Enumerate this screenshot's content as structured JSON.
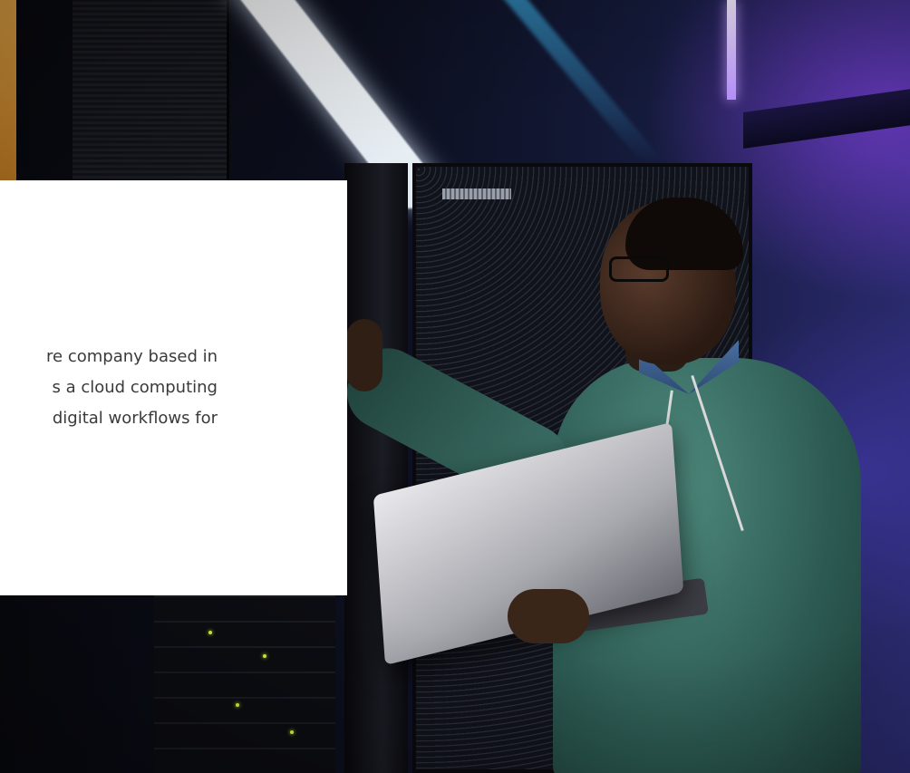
{
  "hero": {
    "image_icon": "photo-server-room-technician"
  },
  "card": {
    "lines": [
      "re company based in",
      "s a cloud computing",
      " digital workflows for"
    ]
  },
  "colors": {
    "card_background": "#ffffff",
    "body_text": "#3a3a3a",
    "accent_purple": "#7a3cd2",
    "accent_blue": "#3aa3d8"
  }
}
